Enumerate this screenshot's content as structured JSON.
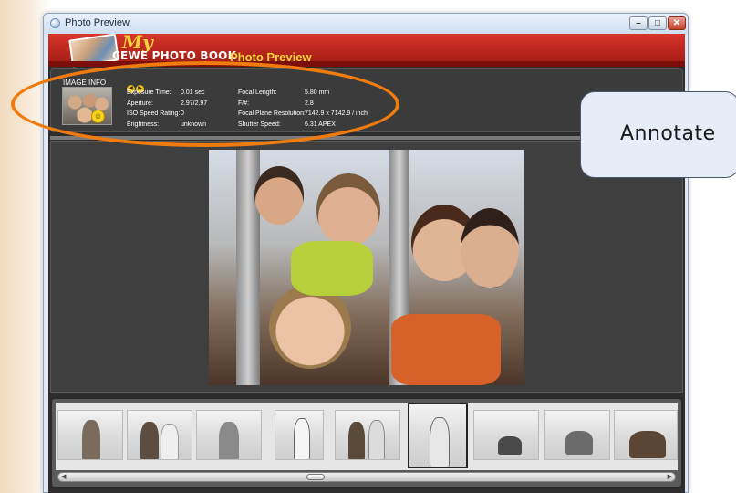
{
  "window": {
    "title": "Photo Preview",
    "controls": {
      "minimize": "–",
      "maximize": "□",
      "close": "✕"
    }
  },
  "header": {
    "logo_my": "My",
    "logo_text": "CEWE PHOTO BOOK",
    "title": "Photo Preview"
  },
  "image_info": {
    "label": "IMAGE INFO",
    "nav_prev_icon": "arrow-left-icon",
    "nav_next_icon": "arrow-right-icon",
    "left": [
      {
        "key": "Exposure Time:",
        "value": "0.01 sec"
      },
      {
        "key": "Aperture:",
        "value": "2.97/2.97"
      },
      {
        "key": "ISO Speed Rating:",
        "value": "0"
      },
      {
        "key": "Brightness:",
        "value": "unknown"
      }
    ],
    "right": [
      {
        "key": "Focal Length:",
        "value": "5.80 mm"
      },
      {
        "key": "F/#:",
        "value": "2.8"
      },
      {
        "key": "Focal Plane Resolution:",
        "value": "7142.9 x 7142.9 / inch"
      },
      {
        "key": "Shutter Speed:",
        "value": "6.31 APEX"
      }
    ]
  },
  "annotation": {
    "callout_label": "Annotate",
    "ellipse_color": "#f07c0f"
  },
  "filmstrip": {
    "selected_index": 5,
    "thumbnail_count": 9
  },
  "colors": {
    "header_red": "#c12a20",
    "header_yellow": "#f5d43a",
    "panel_dark": "#3b3b3b"
  }
}
